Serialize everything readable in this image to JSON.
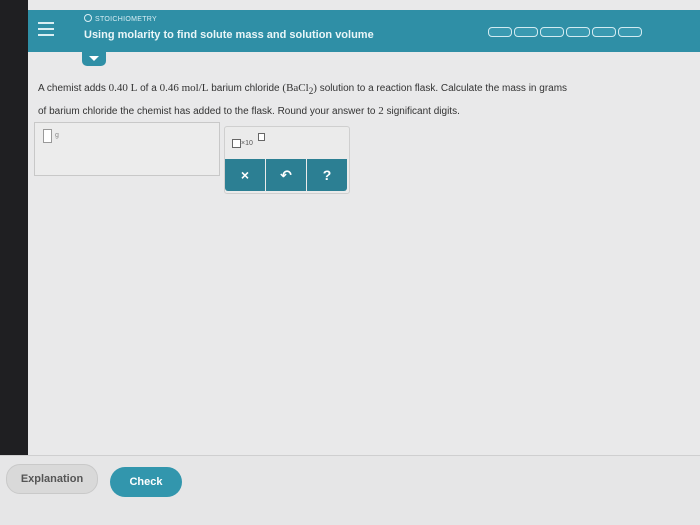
{
  "header": {
    "breadcrumb": "STOICHIOMETRY",
    "title": "Using molarity to find solute mass and solution volume",
    "progress_segments": 6,
    "colors": {
      "bar": "#2f8fa6",
      "button": "#2c7f93",
      "check": "#3296ad"
    }
  },
  "question": {
    "line1_a": "A chemist adds",
    "volume": "0.40 L",
    "line1_b": "of a",
    "concentration": "0.46 mol/L",
    "line1_c": "barium chloride",
    "formula": "(BaCl",
    "formula_sub": "2",
    "formula_close": ")",
    "line1_d": "solution to a reaction flask. Calculate the mass in grams",
    "line2_a": "of barium chloride the chemist has added to the flask. Round your answer to",
    "sig_figs": "2",
    "line2_b": "significant digits."
  },
  "answer": {
    "unit": "g"
  },
  "tools": {
    "sci_x": "×10",
    "clear_icon": "×",
    "undo_icon": "↶",
    "help_icon": "?"
  },
  "footer": {
    "explanation_label": "Explanation",
    "check_label": "Check"
  }
}
